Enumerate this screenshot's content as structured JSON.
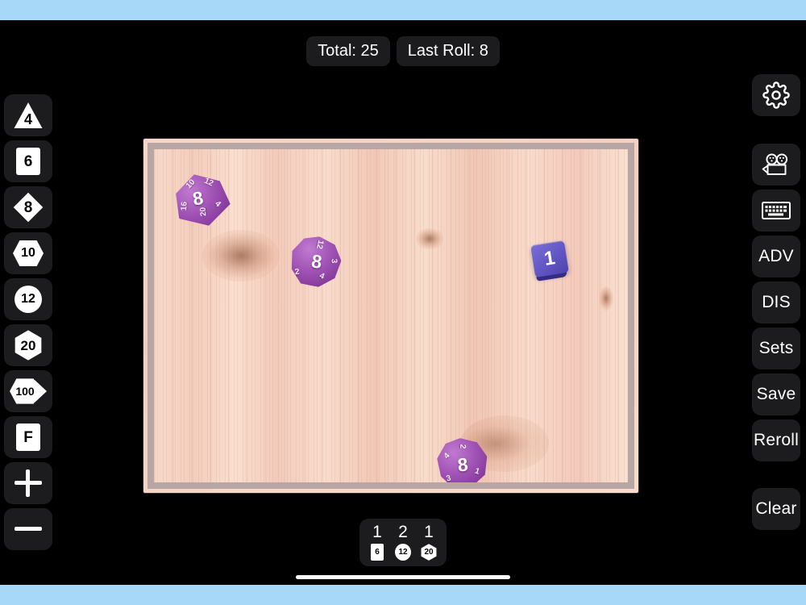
{
  "app": {
    "name": "Dice Roller",
    "background_color": "#000000",
    "safe_area_color": "#a7d8f7",
    "accent_color": "#1c1c1e"
  },
  "status": {
    "total_label": "Total: 25",
    "last_roll_label": "Last Roll: 8",
    "total_value": 25,
    "last_roll_value": 8
  },
  "left_rail": {
    "items": [
      {
        "name": "d4",
        "label": "4",
        "icon": "triangle-die-icon",
        "shape": "tri"
      },
      {
        "name": "d6",
        "label": "6",
        "icon": "square-die-icon",
        "shape": "sq"
      },
      {
        "name": "d8",
        "label": "8",
        "icon": "diamond-die-icon",
        "shape": "dia"
      },
      {
        "name": "d10",
        "label": "10",
        "icon": "wide-hex-die-icon",
        "shape": "hexw"
      },
      {
        "name": "d12",
        "label": "12",
        "icon": "circle-die-icon",
        "shape": "circ"
      },
      {
        "name": "d20",
        "label": "20",
        "icon": "hexagon-die-icon",
        "shape": "hex"
      },
      {
        "name": "d100",
        "label": "100",
        "icon": "double-hex-die-icon",
        "shape": "d100"
      },
      {
        "name": "fudge",
        "label": "F",
        "icon": "fudge-die-icon",
        "shape": "sq"
      },
      {
        "name": "plus",
        "label": "+",
        "icon": "plus-icon",
        "shape": "plus"
      },
      {
        "name": "minus",
        "label": "−",
        "icon": "minus-icon",
        "shape": "minus"
      }
    ]
  },
  "right_rail": {
    "items": [
      {
        "name": "settings",
        "label": "",
        "icon": "gear-icon"
      },
      {
        "name": "record",
        "label": "",
        "icon": "movie-camera-icon"
      },
      {
        "name": "keyboard",
        "label": "",
        "icon": "keyboard-icon"
      },
      {
        "name": "advantage",
        "label": "ADV",
        "icon": ""
      },
      {
        "name": "disadvantage",
        "label": "DIS",
        "icon": ""
      },
      {
        "name": "sets",
        "label": "Sets",
        "icon": ""
      },
      {
        "name": "save",
        "label": "Save",
        "icon": ""
      },
      {
        "name": "reroll",
        "label": "Reroll",
        "icon": ""
      },
      {
        "name": "clear",
        "label": "Clear",
        "icon": ""
      }
    ]
  },
  "table": {
    "surface": "wooden-tray",
    "frame_color": "#f4d2c4",
    "bevel_color": "#b8a6a4",
    "wood_color": "#f5d2c2",
    "dice": [
      {
        "name": "d20-die",
        "type": "d20",
        "value": "8",
        "color": "#a457b8",
        "side_numbers": [
          "10",
          "12",
          "16",
          "20",
          "4"
        ]
      },
      {
        "name": "d12-die-upper",
        "type": "d12",
        "value": "8",
        "color": "#a457b8",
        "side_numbers": [
          "12",
          "2",
          "4",
          "3"
        ]
      },
      {
        "name": "d6-die",
        "type": "d6",
        "value": "1",
        "color": "#6256c4",
        "side_numbers": []
      },
      {
        "name": "d12-die-lower",
        "type": "d12",
        "value": "8",
        "color": "#a457b8",
        "side_numbers": [
          "2",
          "4",
          "3",
          "1"
        ]
      }
    ]
  },
  "results": {
    "rolls": [
      {
        "value": "1",
        "die_type": "6",
        "badge_shape": "square"
      },
      {
        "value": "2",
        "die_type": "12",
        "badge_shape": "circle"
      },
      {
        "value": "1",
        "die_type": "20",
        "badge_shape": "hexagon"
      }
    ]
  }
}
